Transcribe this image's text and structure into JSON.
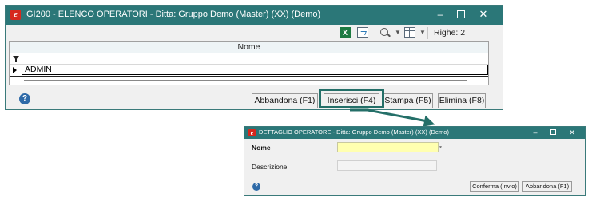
{
  "main_window": {
    "title": "GI200 - ELENCO OPERATORI - Ditta: Gruppo Demo (Master) (XX) (Demo)",
    "app_icon_letter": "e",
    "controls": {
      "minimize": "–",
      "close": "✕"
    },
    "toolbar": {
      "excel_glyph": "X",
      "row_count_label": "Righe: 2"
    },
    "grid": {
      "column_header": "Nome",
      "rows": [
        {
          "nome": "ADMIN"
        }
      ]
    },
    "buttons": {
      "abbandona": "Abbandona (F1)",
      "inserisci": "Inserisci (F4)",
      "stampa": "Stampa (F5)",
      "elimina": "Elimina (F8)"
    },
    "help_glyph": "?"
  },
  "dialog": {
    "title": "DETTAGLIO OPERATORE - Ditta: Gruppo Demo (Master) (XX)  (Demo)",
    "app_icon_letter": "e",
    "controls": {
      "minimize": "–",
      "close": "✕"
    },
    "fields": {
      "nome_label": "Nome",
      "descrizione_label": "Descrizione"
    },
    "buttons": {
      "conferma": "Conferma (Invio)",
      "abbandona": "Abbandona (F1)"
    },
    "help_glyph": "?"
  },
  "colors": {
    "titlebar": "#2b7778",
    "highlight": "#246f68",
    "required_field": "#ffffb0",
    "app_icon": "#d6281d"
  }
}
